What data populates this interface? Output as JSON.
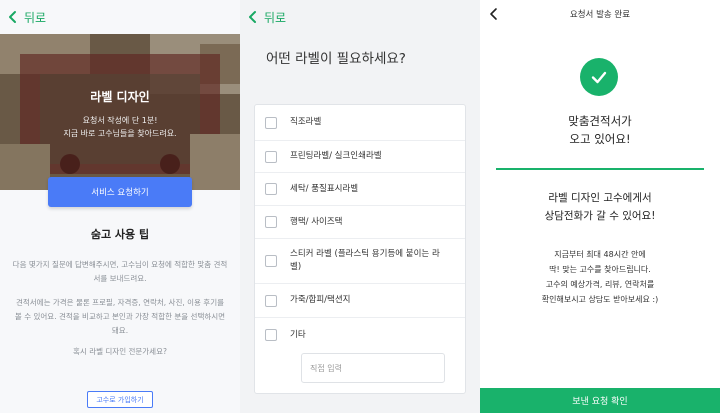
{
  "panel1": {
    "back_label": "뒤로",
    "hero_title": "라벨 디자인",
    "hero_sub_line1": "요청서 작성에 단 1분!",
    "hero_sub_line2": "지금 바로 고수님들을 찾아드려요.",
    "cta_label": "서비스 요청하기",
    "tips_title": "숨고 사용 팁",
    "tips_p1": "다음 몇가지 질문에 답변해주시면, 고수님이 요청에 적합한 맞춤 견적서를 보내드려요.",
    "tips_p2": "견적서에는 가격은 물론 프로필, 자격증, 연락처, 사진, 이용 후기를 볼 수 있어요. 견적을 비교하고 본인과 가장 적합한 분을 선택하시면 돼요.",
    "tips_question": "혹시 라벨 디자인 전문가세요?",
    "join_label": "고수로 가입하기"
  },
  "panel2": {
    "back_label": "뒤로",
    "question": "어떤 라벨이 필요하세요?",
    "options": [
      "직조라벨",
      "프린팅라벨/ 실크인쇄라벨",
      "세탁/ 품질표시라벨",
      "행택/ 사이즈택",
      "스티커 라벨 (플라스틱 용기등에 붙이는 라벨)",
      "가죽/합피/택션지",
      "기타"
    ],
    "input_placeholder": "직접 입력"
  },
  "panel3": {
    "bar_title": "요청서 발송 완료",
    "title_line1": "맞춤견적서가",
    "title_line2": "오고 있어요!",
    "sub_line1": "라벨 디자인 고수에게서",
    "sub_line2": "상담전화가 갈 수 있어요!",
    "desc_line1": "지금부터 최대 48시간 안에",
    "desc_line2": "딱! 맞는 고수를 찾아드립니다.",
    "desc_line3": "고수의 예상가격, 리뷰, 연락처를",
    "desc_line4": "확인해보시고 상담도 받아보세요 :)",
    "bottom_button": "보낸 요청 확인"
  },
  "colors": {
    "green": "#19b26b",
    "blue": "#4a7bf7",
    "muted_text": "#8a8f96"
  }
}
